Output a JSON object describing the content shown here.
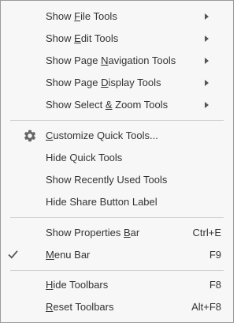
{
  "menu": {
    "groups": [
      {
        "items": [
          {
            "pre": "Show ",
            "key": "F",
            "post": "ile Tools",
            "submenu": true
          },
          {
            "pre": "Show ",
            "key": "E",
            "post": "dit Tools",
            "submenu": true
          },
          {
            "pre": "Show Page ",
            "key": "N",
            "post": "avigation Tools",
            "submenu": true
          },
          {
            "pre": "Show Page ",
            "key": "D",
            "post": "isplay Tools",
            "submenu": true
          },
          {
            "pre": "Show Select ",
            "key": "&",
            "post": " Zoom Tools",
            "submenu": true
          }
        ]
      },
      {
        "items": [
          {
            "pre": "",
            "key": "C",
            "post": "ustomize Quick Tools...",
            "icon": "gear-icon"
          },
          {
            "pre": "Hide Quick Tools",
            "key": "",
            "post": ""
          },
          {
            "pre": "Show Recently Used Tools",
            "key": "",
            "post": ""
          },
          {
            "pre": "Hide Share Button Label",
            "key": "",
            "post": ""
          }
        ]
      },
      {
        "items": [
          {
            "pre": "Show Properties ",
            "key": "B",
            "post": "ar",
            "shortcut": "Ctrl+E"
          },
          {
            "pre": "",
            "key": "M",
            "post": "enu Bar",
            "shortcut": "F9",
            "checked": true,
            "icon": "checkmark-icon"
          }
        ]
      },
      {
        "items": [
          {
            "pre": "",
            "key": "H",
            "post": "ide Toolbars",
            "shortcut": "F8"
          },
          {
            "pre": "",
            "key": "R",
            "post": "eset Toolbars",
            "shortcut": "Alt+F8"
          }
        ]
      }
    ]
  }
}
